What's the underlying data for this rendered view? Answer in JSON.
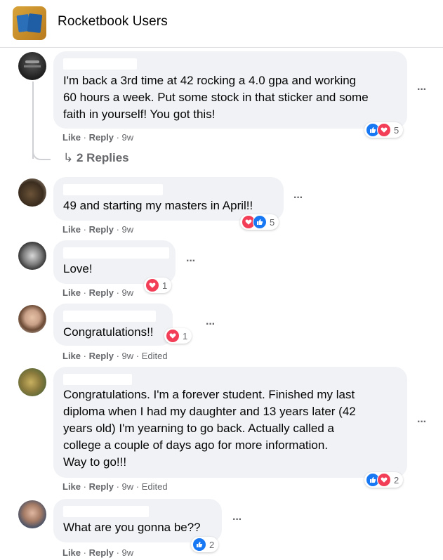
{
  "group": {
    "title": "Rocketbook Users"
  },
  "labels": {
    "like": "Like",
    "reply": "Reply",
    "more": "···"
  },
  "comments": [
    {
      "text": [
        "I'm back a 3rd time at 42 rocking a 4.0 gpa and working",
        "60 hours a week. Put some stock in that sticker and some",
        "faith in yourself! You got this!"
      ],
      "time": "9w",
      "edited": "",
      "reaction_count": "5",
      "reactions": [
        "like-icon",
        "love-icon"
      ]
    },
    {
      "text": [
        "49 and starting my masters in April!!"
      ],
      "time": "9w",
      "edited": "",
      "reaction_count": "5",
      "reactions": [
        "love-icon",
        "like-icon"
      ]
    },
    {
      "text": [
        "Love!"
      ],
      "time": "9w",
      "edited": "",
      "reaction_count": "1",
      "reactions": [
        "love-icon"
      ]
    },
    {
      "text": [
        "Congratulations!!"
      ],
      "time": "9w",
      "edited": "Edited",
      "reaction_count": "1",
      "reactions": [
        "love-icon"
      ]
    },
    {
      "text": [
        "Congratulations. I'm a forever student. Finished my last",
        "diploma when I had my daughter and 13 years later (42",
        "years old) I'm yearning to go back. Actually called a",
        "college a couple of days ago for more information.",
        "Way to go!!!"
      ],
      "time": "9w",
      "edited": "Edited",
      "reaction_count": "2",
      "reactions": [
        "like-icon",
        "love-icon"
      ]
    },
    {
      "text": [
        "What are you gonna be??"
      ],
      "time": "9w",
      "edited": "",
      "reaction_count": "2",
      "reactions": [
        "like-icon"
      ]
    }
  ],
  "replies_link": {
    "label": "2 Replies"
  },
  "colors": {
    "like": "#1877f2",
    "love": "#f33e58",
    "bubble": "#f0f2f5",
    "meta": "#65676b"
  }
}
